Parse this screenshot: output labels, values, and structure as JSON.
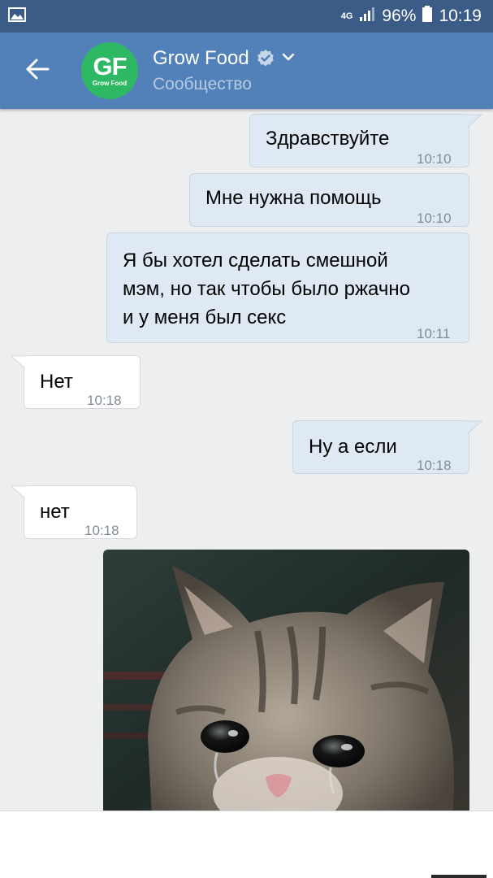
{
  "status_bar": {
    "network": "4G",
    "battery": "96%",
    "time": "10:19"
  },
  "header": {
    "title": "Grow Food",
    "subtitle": "Сообщество",
    "avatar": {
      "initials": "GF",
      "caption": "Grow Food",
      "color": "#2fb864"
    }
  },
  "messages": [
    {
      "direction": "out",
      "lines": [
        "Здравствуйте"
      ],
      "time": "10:10"
    },
    {
      "direction": "out",
      "lines": [
        "Мне нужна помощь"
      ],
      "time": "10:10"
    },
    {
      "direction": "out",
      "lines": [
        "Я бы хотел сделать смешной",
        "мэм, но так чтобы было ржачно",
        "и у меня был секс"
      ],
      "time": "10:11"
    },
    {
      "direction": "in",
      "lines": [
        "Нет"
      ],
      "time": "10:18"
    },
    {
      "direction": "out",
      "lines": [
        "Ну а если"
      ],
      "time": "10:18"
    },
    {
      "direction": "in",
      "lines": [
        "нет"
      ],
      "time": "10:18"
    }
  ],
  "photo": {
    "subject": "crying kitten photo"
  },
  "colors": {
    "status_bar": "#3b5c86",
    "header": "#5181b8",
    "outgoing_bubble": "#dfe9f4",
    "incoming_bubble": "#ffffff",
    "background": "#edeef0"
  }
}
